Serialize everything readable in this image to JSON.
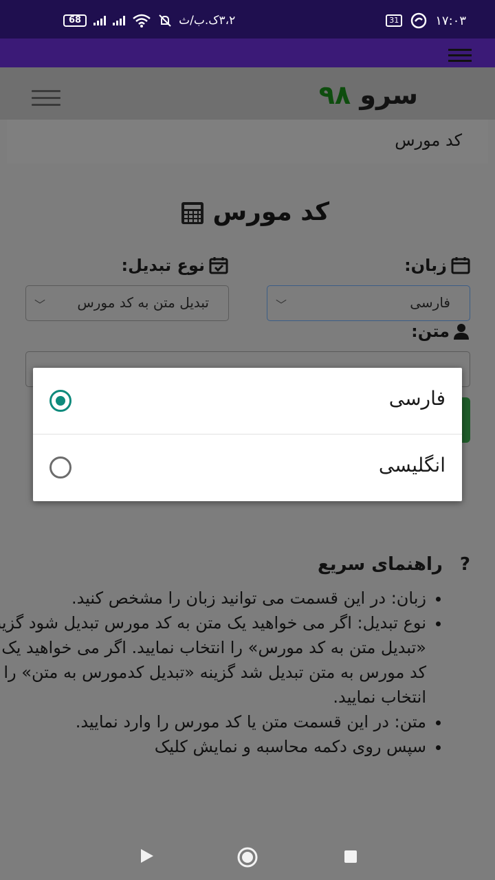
{
  "status_bar": {
    "battery": "68",
    "date_text": "۳،۲ک.ب/ث",
    "calendar_day": "31",
    "time": "۱۷:۰۳"
  },
  "header": {
    "logo_word": "سرو",
    "logo_number": "۹۸"
  },
  "breadcrumb": {
    "current": "کد مورس"
  },
  "page": {
    "title": "کد مورس"
  },
  "form": {
    "language_label": "زبان:",
    "language_value": "فارسی",
    "conversion_label": "نوع تبدیل:",
    "conversion_value": "تبدیل متن به کد مورس",
    "text_label": "متن:",
    "text_value": ""
  },
  "language_dialog": {
    "options": [
      {
        "label": "فارسی",
        "selected": true
      },
      {
        "label": "انگلیسی",
        "selected": false
      }
    ],
    "accent_color": "#0e8a7c"
  },
  "help": {
    "title": "راهنمای سریع",
    "icon": "question-icon",
    "items": [
      "زبان: در این قسمت می توانید زبان را مشخص کنید.",
      "نوع تبدیل: اگر می خواهید یک متن به کد مورس تبدیل شود گزینه «تبدیل متن به کد مورس» را انتخاب نمایید. اگر می خواهید یک کد مورس به متن تبدیل شد گزینه «تبدیل کدمورس به متن» را انتخاب نمایید.",
      "متن: در این قسمت متن یا کد مورس را وارد نمایید.",
      "سپس روی دکمه محاسبه و نمایش کلیک"
    ]
  },
  "colors": {
    "status_bar": "#1f0f4f",
    "browser_bar": "#3b1a77",
    "logo_number": "#0e4d0e",
    "scrim_background": "#7d7d7d"
  }
}
